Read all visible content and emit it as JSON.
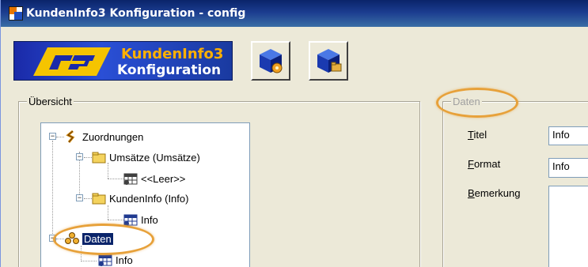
{
  "window": {
    "title": "KundenInfo3 Konfiguration - config"
  },
  "toolbar": {
    "banner_line1_a": "KundenInfo",
    "banner_line1_b": "3",
    "banner_line2": "Konfiguration",
    "buttons": [
      {
        "icon": "settings-cube-icon"
      },
      {
        "icon": "folder-cube-icon"
      }
    ]
  },
  "overview": {
    "title": "Übersicht",
    "tree": [
      {
        "label": "Zuordnungen",
        "icon": "assignments-icon"
      },
      {
        "label": "Umsätze (Umsätze)",
        "icon": "folder-icon"
      },
      {
        "label": "<<Leer>>",
        "icon": "grid-icon"
      },
      {
        "label": "KundenInfo (Info)",
        "icon": "folder-icon"
      },
      {
        "label": "Info",
        "icon": "grid-icon"
      },
      {
        "label": "Daten",
        "icon": "data-icon",
        "selected": true
      },
      {
        "label": "Info",
        "icon": "grid-icon"
      }
    ]
  },
  "details": {
    "title": "Daten",
    "titel_label_u": "T",
    "titel_label_rest": "itel",
    "titel_value": "Info",
    "format_label_u": "F",
    "format_label_rest": "ormat",
    "format_value": "Info",
    "bemerkung_label_u": "B",
    "bemerkung_label_rest": "emerkung",
    "bemerkung_value": ""
  },
  "colors": {
    "titlebar": "#0a246a",
    "selection": "#0a246a",
    "highlight": "#e7a13a",
    "face": "#ece9d8"
  }
}
